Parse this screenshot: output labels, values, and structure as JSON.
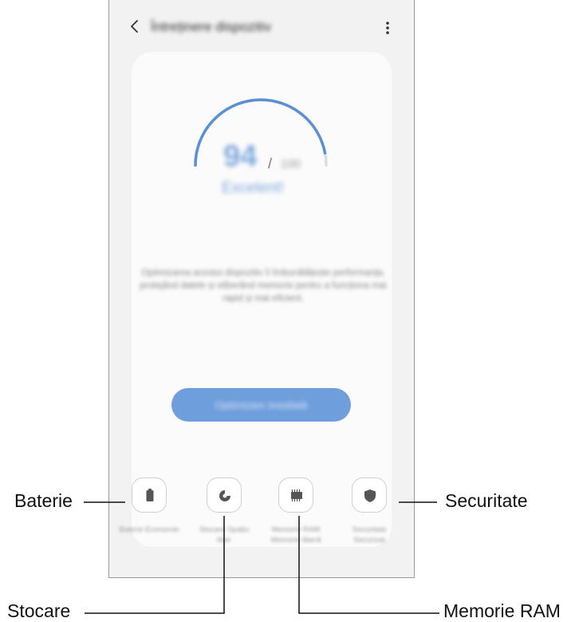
{
  "header": {
    "title": "Întreținere dispozitiv"
  },
  "score": {
    "value": "94",
    "separator": "/",
    "max": "100",
    "status": "Excelent!",
    "level": 0.94
  },
  "description": "Optimizarea acestui dispozitiv îi îmbunătățește performanța, protejând datele și eliberând memorie pentru a funcționa mai rapid și mai eficient.",
  "optimize_button": "Optimizare imediată",
  "features": [
    {
      "label": "Baterie Economie"
    },
    {
      "label": "Stocare Spațiu liber"
    },
    {
      "label": "Memorie RAM Memorie liberă"
    },
    {
      "label": "Securitate Securizat"
    }
  ],
  "callouts": {
    "battery": "Baterie",
    "storage": "Stocare",
    "security": "Securitate",
    "ram": "Memorie RAM"
  },
  "colors": {
    "accent": "#5b8fd6",
    "background": "#f2f2f2",
    "card": "#fbfbfb"
  },
  "icons": {
    "back": "chevron-left-icon",
    "more": "more-vertical-icon",
    "battery": "battery-icon",
    "storage": "pie-chart-icon",
    "ram": "memory-chip-icon",
    "security": "shield-icon"
  }
}
